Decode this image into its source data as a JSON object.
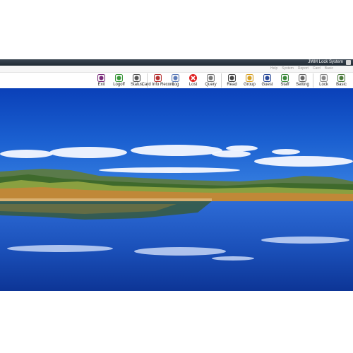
{
  "window": {
    "title": "JWM Lock System"
  },
  "menu": {
    "items": [
      "Basic",
      "Card",
      "Report",
      "System",
      "Help"
    ]
  },
  "toolbar": {
    "tools": [
      {
        "name": "basic",
        "label": "Basic",
        "icon": "basic-icon",
        "color": "#4a7a3a"
      },
      {
        "name": "lock",
        "label": "Lock",
        "icon": "lock-icon",
        "color": "#888888"
      },
      {
        "name": "setting",
        "label": "Setting",
        "icon": "setting-icon",
        "color": "#666666"
      },
      {
        "name": "staff",
        "label": "Staff",
        "icon": "staff-icon",
        "color": "#3a8a3a"
      },
      {
        "name": "guest",
        "label": "Guest",
        "icon": "guest-icon",
        "color": "#2a4a9a"
      },
      {
        "name": "group",
        "label": "Group",
        "icon": "group-icon",
        "color": "#d8a020"
      },
      {
        "name": "read",
        "label": "Read",
        "icon": "read-icon",
        "color": "#444444"
      },
      {
        "name": "query",
        "label": "Query",
        "icon": "query-icon",
        "color": "#777777"
      },
      {
        "name": "lost",
        "label": "Lost",
        "icon": "lost-icon",
        "color": "#d82020"
      },
      {
        "name": "log",
        "label": "Log",
        "icon": "log-icon",
        "color": "#5a7ab8"
      },
      {
        "name": "card-info-record",
        "label": "Card Info Record",
        "icon": "card-info-record-icon",
        "color": "#b83030"
      },
      {
        "name": "status",
        "label": "Status",
        "icon": "status-icon",
        "color": "#555555"
      },
      {
        "name": "logoff",
        "label": "Logoff",
        "icon": "logoff-icon",
        "color": "#3a9a3a"
      },
      {
        "name": "exit",
        "label": "Exit",
        "icon": "exit-icon",
        "color": "#7a2a7a"
      }
    ]
  }
}
